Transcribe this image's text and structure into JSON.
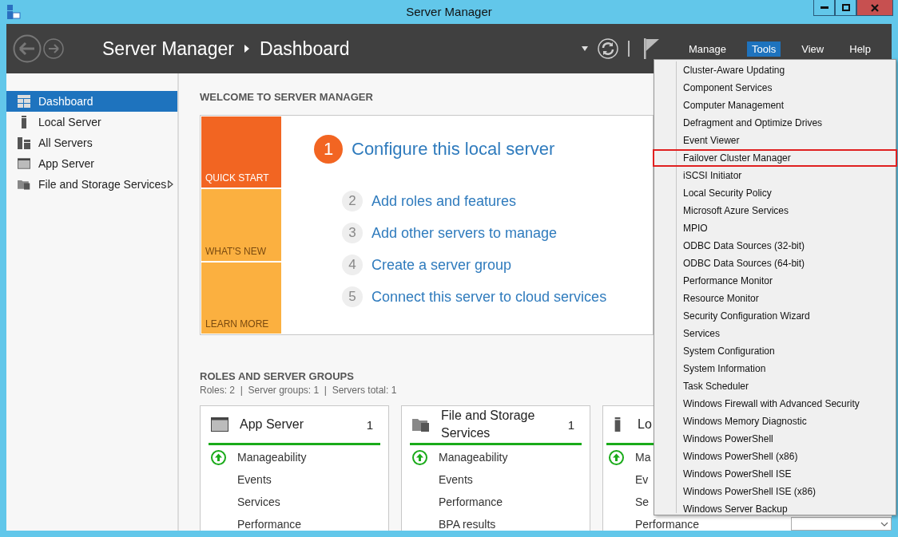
{
  "window": {
    "title": "Server Manager"
  },
  "header": {
    "breadcrumb": [
      "Server Manager",
      "Dashboard"
    ],
    "menus": [
      {
        "label": "Manage",
        "selected": false
      },
      {
        "label": "Tools",
        "selected": true
      },
      {
        "label": "View",
        "selected": false
      },
      {
        "label": "Help",
        "selected": false
      }
    ]
  },
  "sidebar": {
    "items": [
      {
        "label": "Dashboard",
        "kind": "dashboard",
        "selected": true,
        "has_submenu": false
      },
      {
        "label": "Local Server",
        "kind": "server",
        "selected": false,
        "has_submenu": false
      },
      {
        "label": "All Servers",
        "kind": "servers",
        "selected": false,
        "has_submenu": false
      },
      {
        "label": "App Server",
        "kind": "app",
        "selected": false,
        "has_submenu": false
      },
      {
        "label": "File and Storage Services",
        "kind": "files",
        "selected": false,
        "has_submenu": true
      }
    ]
  },
  "welcome": {
    "title": "WELCOME TO SERVER MANAGER",
    "tiles": [
      {
        "label": "QUICK START",
        "selected": true
      },
      {
        "label": "WHAT'S NEW",
        "selected": false
      },
      {
        "label": "LEARN MORE",
        "selected": false
      }
    ],
    "steps": [
      {
        "number": "1",
        "text": "Configure this local server",
        "kind": "primary"
      },
      {
        "number": "2",
        "text": "Add roles and features",
        "kind": "secondary"
      },
      {
        "number": "3",
        "text": "Add other servers to manage",
        "kind": "secondary"
      },
      {
        "number": "4",
        "text": "Create a server group",
        "kind": "secondary"
      },
      {
        "number": "5",
        "text": "Connect this server to cloud services",
        "kind": "secondary"
      }
    ]
  },
  "roles": {
    "title": "ROLES AND SERVER GROUPS",
    "summary": "Roles: 2  |  Server groups: 1  |  Servers total: 1",
    "cards": [
      {
        "title": "App Server",
        "count": "1",
        "kind": "app",
        "rows": [
          {
            "label": "Manageability",
            "kind": "status"
          },
          {
            "label": "Events",
            "kind": "plain"
          },
          {
            "label": "Services",
            "kind": "plain"
          },
          {
            "label": "Performance",
            "kind": "plain"
          }
        ]
      },
      {
        "title": "File and Storage Services",
        "count": "1",
        "kind": "files",
        "rows": [
          {
            "label": "Manageability",
            "kind": "status"
          },
          {
            "label": "Events",
            "kind": "plain"
          },
          {
            "label": "Performance",
            "kind": "plain"
          },
          {
            "label": "BPA results",
            "kind": "plain"
          }
        ]
      },
      {
        "title": "Lo",
        "kind": "server",
        "rows": [
          {
            "label": "Ma",
            "kind": "status"
          },
          {
            "label": "Ev",
            "kind": "plain"
          },
          {
            "label": "Se",
            "kind": "plain"
          },
          {
            "label": "Performance",
            "kind": "plain"
          }
        ]
      }
    ]
  },
  "tools_menu": {
    "items": [
      {
        "label": "Cluster-Aware Updating",
        "selected": false
      },
      {
        "label": "Component Services",
        "selected": false
      },
      {
        "label": "Computer Management",
        "selected": false
      },
      {
        "label": "Defragment and Optimize Drives",
        "selected": false
      },
      {
        "label": "Event Viewer",
        "selected": false
      },
      {
        "label": "Failover Cluster Manager",
        "selected": true
      },
      {
        "label": "iSCSI Initiator",
        "selected": false
      },
      {
        "label": "Local Security Policy",
        "selected": false
      },
      {
        "label": "Microsoft Azure Services",
        "selected": false
      },
      {
        "label": "MPIO",
        "selected": false
      },
      {
        "label": "ODBC Data Sources (32-bit)",
        "selected": false
      },
      {
        "label": "ODBC Data Sources (64-bit)",
        "selected": false
      },
      {
        "label": "Performance Monitor",
        "selected": false
      },
      {
        "label": "Resource Monitor",
        "selected": false
      },
      {
        "label": "Security Configuration Wizard",
        "selected": false
      },
      {
        "label": "Services",
        "selected": false
      },
      {
        "label": "System Configuration",
        "selected": false
      },
      {
        "label": "System Information",
        "selected": false
      },
      {
        "label": "Task Scheduler",
        "selected": false
      },
      {
        "label": "Windows Firewall with Advanced Security",
        "selected": false
      },
      {
        "label": "Windows Memory Diagnostic",
        "selected": false
      },
      {
        "label": "Windows PowerShell",
        "selected": false
      },
      {
        "label": "Windows PowerShell (x86)",
        "selected": false
      },
      {
        "label": "Windows PowerShell ISE",
        "selected": false
      },
      {
        "label": "Windows PowerShell ISE (x86)",
        "selected": false
      },
      {
        "label": "Windows Server Backup",
        "selected": false
      }
    ]
  }
}
